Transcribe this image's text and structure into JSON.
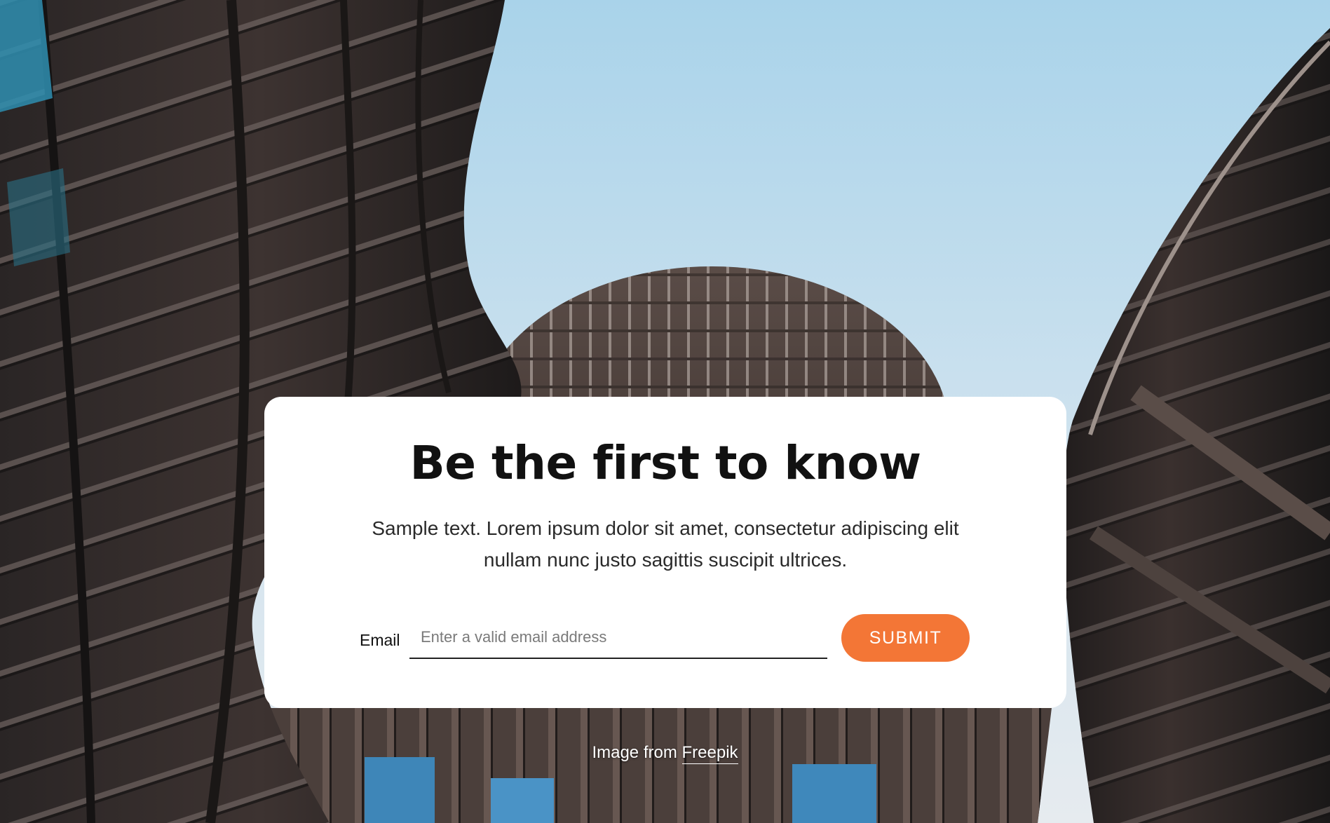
{
  "hero": {
    "image_subject": "modern-building-facade-looking-up"
  },
  "card": {
    "title": "Be the first to know",
    "description": "Sample text. Lorem ipsum dolor sit amet, consectetur adipiscing elit nullam nunc justo sagittis suscipit ultrices.",
    "form": {
      "email_label": "Email",
      "email_placeholder": "Enter a valid email address",
      "email_value": "",
      "submit_label": "SUBMIT"
    }
  },
  "credit": {
    "prefix": "Image from",
    "link_text": "Freepik"
  },
  "colors": {
    "accent": "#f37636",
    "card_background": "#ffffff",
    "title_text": "#111111"
  }
}
